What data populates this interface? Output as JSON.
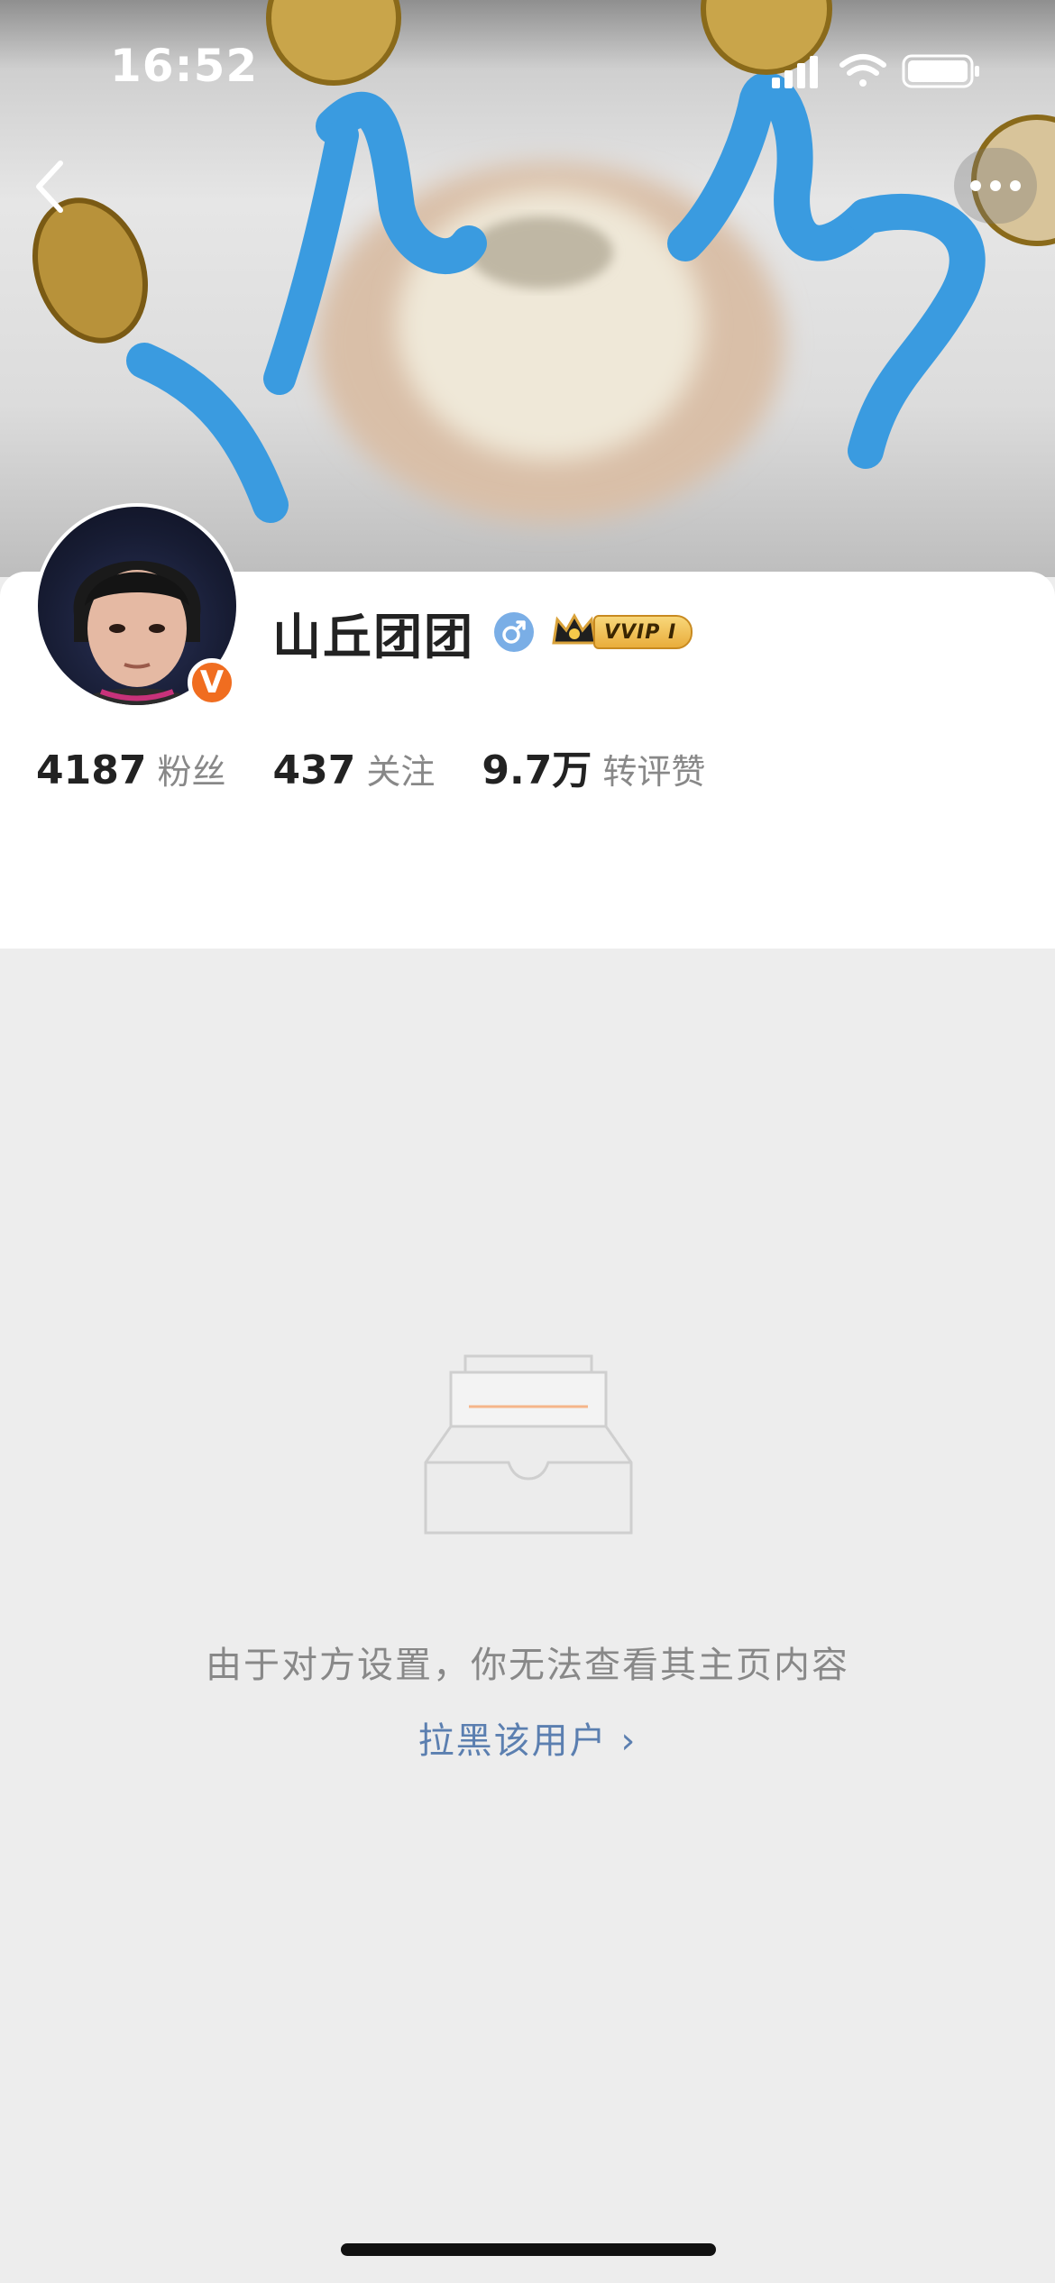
{
  "status_bar": {
    "time": "16:52",
    "icons": [
      "cellular-signal-icon",
      "wifi-icon",
      "battery-icon"
    ]
  },
  "navigation": {
    "back_icon": "chevron-left-icon",
    "more_icon": "more-dots-icon"
  },
  "profile": {
    "username": "山丘团团",
    "gender_icon": "male-icon",
    "verified_badge": "V",
    "vip_label": "VVIP Ⅰ",
    "stats": [
      {
        "value": "4187",
        "label": "粉丝"
      },
      {
        "value": "437",
        "label": "关注"
      },
      {
        "value": "9.7万",
        "label": "转评赞"
      }
    ]
  },
  "empty_state": {
    "icon": "empty-inbox-icon",
    "message": "由于对方设置，你无法查看其主页内容",
    "block_link": "拉黑该用户 ›"
  },
  "colors": {
    "accent_link": "#5b7fb0",
    "verified_orange": "#f06d20",
    "gender_blue": "#7aaee6",
    "vip_gold": "#e9ad3c",
    "cover_blue": "#3a9be0"
  }
}
